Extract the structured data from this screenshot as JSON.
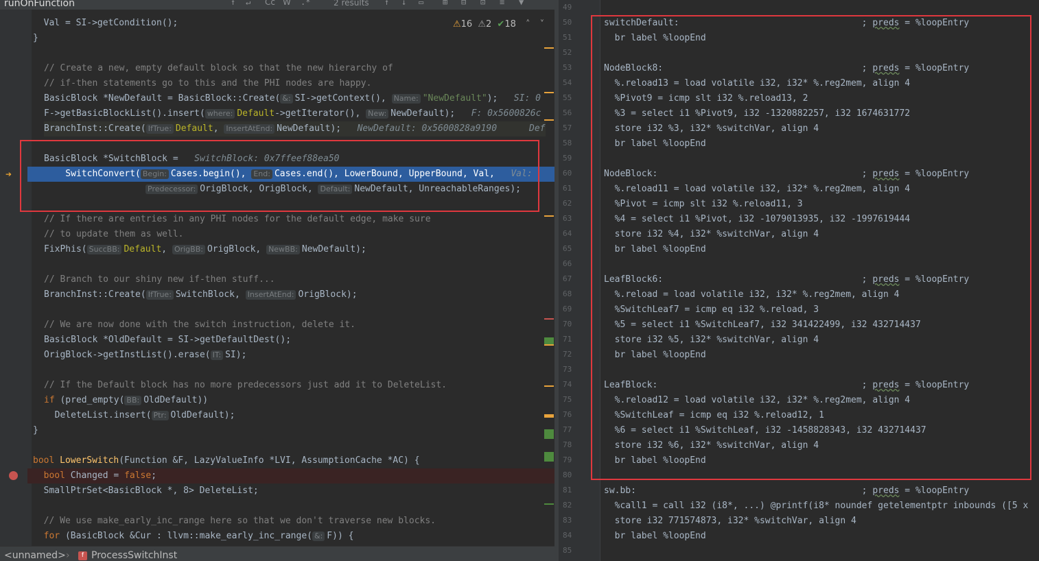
{
  "find_bar": {
    "query": "runOnFunction",
    "results": "2 results"
  },
  "inspections": {
    "warnings": "16",
    "weak_warnings": "2",
    "ok": "18"
  },
  "breadcrumb": {
    "item1": "<unnamed>",
    "item2": "ProcessSwitchInst",
    "badge": "f"
  },
  "left_code": {
    "l1": "  Val = SI->getCondition();",
    "l2": "}",
    "l4": "// Create a new, empty default block so that the new hierarchy of",
    "l5": "// if-then statements go to this and the PHI nodes are happy.",
    "l6_a": "BasicBlock *NewDefault = BasicBlock::Create(",
    "l6_h1": "&:",
    "l6_b": "SI->getContext(), ",
    "l6_h2": "Name:",
    "l6_str": "\"NewDefault\"",
    "l6_c": ");",
    "l6_dbg": "   SI: 0",
    "l7_a": "F->getBasicBlockList().insert(",
    "l7_h1": "where:",
    "l7_f": "Default",
    "l7_b": "->getIterator(), ",
    "l7_h2": "New:",
    "l7_c": "NewDefault);",
    "l7_dbg": "   F: 0x5600826c",
    "l8_a": "BranchInst::Create(",
    "l8_h1": "IfTrue:",
    "l8_f": "Default",
    "l8_b": ", ",
    "l8_h2": "InsertAtEnd:",
    "l8_c": "NewDefault);",
    "l8_dbg": "   NewDefault: 0x5600828a9190      Def",
    "l10_a": "BasicBlock *SwitchBlock = ",
    "l10_dbg": "  SwitchBlock: 0x7ffeef88ea50",
    "l11_a": "    SwitchConvert(",
    "l11_h1": "Begin:",
    "l11_b": "Cases.begin(), ",
    "l11_h2": "End:",
    "l11_c": "Cases.end(), LowerBound, UpperBound, Val,",
    "l11_dbg": "   Val: ",
    "l12_h1": "Predecessor:",
    "l12_a": "OrigBlock, OrigBlock, ",
    "l12_h2": "Default:",
    "l12_b": "NewDefault, UnreachableRanges);",
    "l14": "// If there are entries in any PHI nodes for the default edge, make sure",
    "l15": "// to update them as well.",
    "l16_a": "FixPhis(",
    "l16_h1": "SuccBB:",
    "l16_f": "Default",
    "l16_b": ", ",
    "l16_h2": "OrigBB:",
    "l16_c": "OrigBlock, ",
    "l16_h3": "NewBB:",
    "l16_d": "NewDefault);",
    "l18": "// Branch to our shiny new if-then stuff...",
    "l19_a": "BranchInst::Create(",
    "l19_h1": "IfTrue:",
    "l19_b": "SwitchBlock, ",
    "l19_h2": "InsertAtEnd:",
    "l19_c": "OrigBlock);",
    "l21": "// We are now done with the switch instruction, delete it.",
    "l22": "BasicBlock *OldDefault = SI->getDefaultDest();",
    "l23_a": "OrigBlock->getInstList().erase(",
    "l23_h1": "IT:",
    "l23_b": "SI);",
    "l25": "// If the Default block has no more predecessors just add it to DeleteList.",
    "l26_kw": "if",
    "l26_a": " (pred_empty(",
    "l26_h1": "BB:",
    "l26_b": "OldDefault))",
    "l27_a": "  DeleteList.insert(",
    "l27_h1": "Ptr:",
    "l27_b": "OldDefault);",
    "l28": "}",
    "l30_kw": "bool",
    "l30_fn": " LowerSwitch",
    "l30_a": "(Function &F, LazyValueInfo *LVI, AssumptionCache *AC) {",
    "l31_kw": "  bool",
    "l31_a": " Changed = ",
    "l31_kw2": "false",
    "l31_b": ";",
    "l32": "  SmallPtrSet<BasicBlock *, 8> DeleteList;",
    "l34": "  // We use make_early_inc_range here so that we don't traverse new blocks.",
    "l35_kw": "  for",
    "l35_a": " (BasicBlock &Cur : llvm::make_early_inc_range(",
    "l35_h1": "&:",
    "l35_b": "F)) {"
  },
  "right_code": {
    "line_numbers": [
      "49",
      "50",
      "51",
      "52",
      "53",
      "54",
      "55",
      "56",
      "57",
      "58",
      "59",
      "60",
      "61",
      "62",
      "63",
      "64",
      "65",
      "66",
      "67",
      "68",
      "69",
      "70",
      "71",
      "72",
      "73",
      "74",
      "75",
      "76",
      "77",
      "78",
      "79",
      "80",
      "81",
      "82",
      "83",
      "84",
      "85"
    ],
    "preds_word": "preds",
    "r50_a": "switchDefault:                                  ; ",
    "r50_b": " = %loopEntry",
    "r51": "  br label %loopEnd",
    "r53_a": "NodeBlock8:                                     ; ",
    "r53_b": " = %loopEntry",
    "r54": "  %.reload13 = load volatile i32, i32* %.reg2mem, align 4",
    "r55": "  %Pivot9 = icmp slt i32 %.reload13, 2",
    "r56": "  %3 = select i1 %Pivot9, i32 -1320882257, i32 1674631772",
    "r57": "  store i32 %3, i32* %switchVar, align 4",
    "r58": "  br label %loopEnd",
    "r60_a": "NodeBlock:                                      ; ",
    "r60_b": " = %loopEntry",
    "r61": "  %.reload11 = load volatile i32, i32* %.reg2mem, align 4",
    "r62": "  %Pivot = icmp slt i32 %.reload11, 3",
    "r63": "  %4 = select i1 %Pivot, i32 -1079013935, i32 -1997619444",
    "r64": "  store i32 %4, i32* %switchVar, align 4",
    "r65": "  br label %loopEnd",
    "r67_a": "LeafBlock6:                                     ; ",
    "r67_b": " = %loopEntry",
    "r68": "  %.reload = load volatile i32, i32* %.reg2mem, align 4",
    "r69": "  %SwitchLeaf7 = icmp eq i32 %.reload, 3",
    "r70": "  %5 = select i1 %SwitchLeaf7, i32 341422499, i32 432714437",
    "r71": "  store i32 %5, i32* %switchVar, align 4",
    "r72": "  br label %loopEnd",
    "r74_a": "LeafBlock:                                      ; ",
    "r74_b": " = %loopEntry",
    "r75": "  %.reload12 = load volatile i32, i32* %.reg2mem, align 4",
    "r76": "  %SwitchLeaf = icmp eq i32 %.reload12, 1",
    "r77": "  %6 = select i1 %SwitchLeaf, i32 -1458828343, i32 432714437",
    "r78": "  store i32 %6, i32* %switchVar, align 4",
    "r79": "  br label %loopEnd",
    "r81_a": "sw.bb:                                          ; ",
    "r81_b": " = %loopEntry",
    "r82": "  %call1 = call i32 (i8*, ...) @printf(i8* noundef getelementptr inbounds ([5 x",
    "r83": "  store i32 771574873, i32* %switchVar, align 4",
    "r84": "  br label %loopEnd"
  },
  "colors": {
    "background": "#2b2b2b",
    "current_line": "#2d5d9e",
    "highlight_box": "#e0383e",
    "keyword": "#cc7832",
    "comment": "#808080",
    "string": "#6a8759"
  }
}
